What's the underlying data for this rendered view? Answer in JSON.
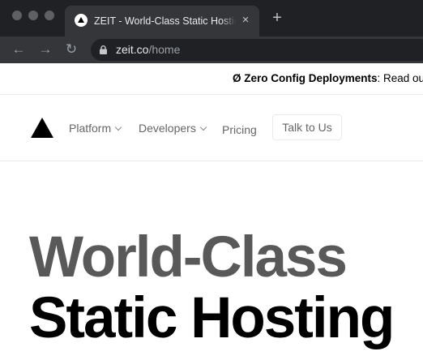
{
  "browser": {
    "tab": {
      "title": "ZEIT - World-Class Static Hosting",
      "close_icon": "×"
    },
    "new_tab_icon": "+",
    "toolbar": {
      "back_icon": "←",
      "forward_icon": "→",
      "reload_icon": "↻",
      "url_host": "zeit.co",
      "url_path": "/home"
    }
  },
  "page": {
    "announcement": {
      "strong": "Ø Zero Config Deployments",
      "text": ": Read our"
    },
    "nav": {
      "items": [
        {
          "label": "Platform"
        },
        {
          "label": "Developers"
        },
        {
          "label": "Pricing"
        }
      ],
      "cta": "Talk to Us"
    },
    "hero": {
      "line1": "World-Class",
      "line2": "Static Hosting"
    }
  }
}
